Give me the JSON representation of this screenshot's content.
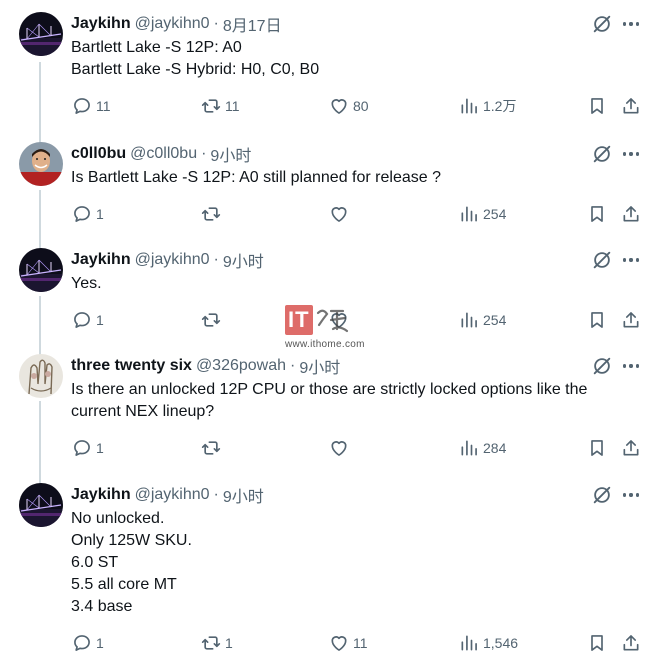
{
  "tweets": [
    {
      "name": "Jaykihn",
      "handle": "@jaykihn0",
      "sep": "·",
      "time": "8月17日",
      "lines": [
        "Bartlett Lake -S 12P: A0",
        "Bartlett Lake -S Hybrid: H0, C0, B0"
      ],
      "replies": "11",
      "reposts": "11",
      "likes": "80",
      "views": "1.2万"
    },
    {
      "name": "c0ll0bu",
      "handle": "@c0ll0bu",
      "sep": "·",
      "time": "9小时",
      "lines": [
        "Is Bartlett Lake -S 12P: A0 still planned for release ?"
      ],
      "replies": "1",
      "reposts": "",
      "likes": "",
      "views": "254"
    },
    {
      "name": "Jaykihn",
      "handle": "@jaykihn0",
      "sep": "·",
      "time": "9小时",
      "lines": [
        "Yes."
      ],
      "replies": "1",
      "reposts": "",
      "likes": "",
      "views": "254"
    },
    {
      "name": "three twenty six",
      "handle": "@326powah",
      "sep": "·",
      "time": "9小时",
      "lines": [
        "Is there an unlocked 12P CPU or those are strictly locked options like the",
        "current NEX lineup?"
      ],
      "replies": "1",
      "reposts": "",
      "likes": "",
      "views": "284"
    },
    {
      "name": "Jaykihn",
      "handle": "@jaykihn0",
      "sep": "·",
      "time": "9小时",
      "lines": [
        "No unlocked.",
        "Only 125W SKU.",
        "6.0 ST",
        "5.5 all core MT",
        "3.4 base"
      ],
      "replies": "1",
      "reposts": "1",
      "likes": "11",
      "views": "1,546"
    }
  ],
  "watermark": {
    "logo_text": "IT",
    "url": "www.ithome.com"
  },
  "colors": {
    "text": "#0f1419",
    "secondary": "#536471",
    "thread_line": "#cfd9de",
    "watermark_red": "#d9534f"
  },
  "icons": {
    "reply": "reply-icon",
    "repost": "repost-icon",
    "like": "heart-icon",
    "views": "views-chart-icon",
    "bookmark": "bookmark-icon",
    "share": "share-icon",
    "grok": "grok-icon",
    "more": "more-dots-icon"
  }
}
